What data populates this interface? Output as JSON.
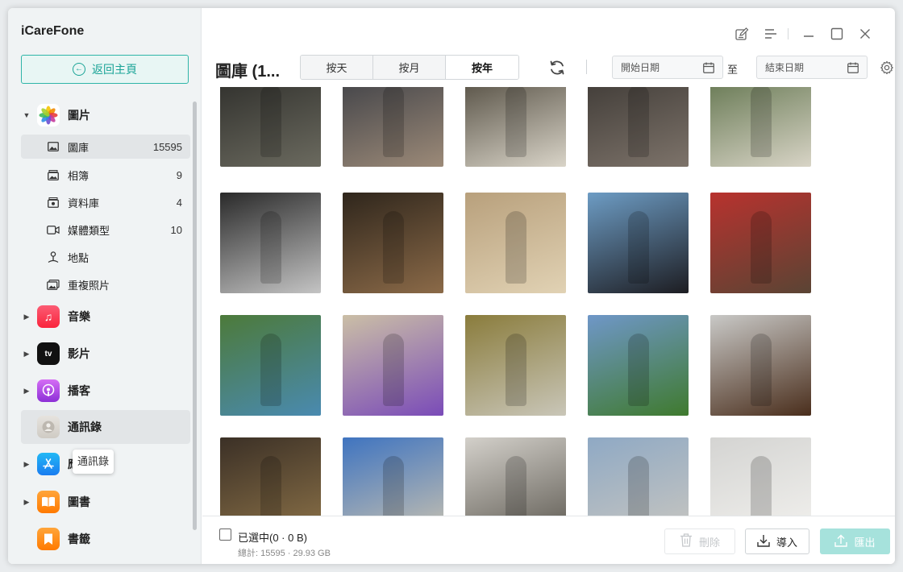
{
  "app": {
    "title": "iCareFone"
  },
  "sidebar": {
    "home_label": "返回主頁",
    "categories": [
      {
        "label": "圖片",
        "icon": "photos-app-icon",
        "expanded": true
      },
      {
        "label": "音樂",
        "icon": "music-app-icon"
      },
      {
        "label": "影片",
        "icon": "apple-tv-app-icon"
      },
      {
        "label": "播客",
        "icon": "podcasts-app-icon"
      },
      {
        "label": "通訊錄",
        "icon": "contacts-app-icon"
      },
      {
        "label": "應用",
        "icon": "app-store-icon"
      },
      {
        "label": "圖書",
        "icon": "books-app-icon"
      },
      {
        "label": "書籤",
        "icon": "bookmarks-app-icon"
      }
    ],
    "photo_items": [
      {
        "label": "圖庫",
        "count": "15595",
        "icon": "image-icon"
      },
      {
        "label": "相簿",
        "count": "9",
        "icon": "album-icon"
      },
      {
        "label": "資料庫",
        "count": "4",
        "icon": "library-icon"
      },
      {
        "label": "媒體類型",
        "count": "10",
        "icon": "video-camera-icon"
      },
      {
        "label": "地點",
        "count": "",
        "icon": "location-pin-icon"
      },
      {
        "label": "重複照片",
        "count": "",
        "icon": "duplicate-photos-icon"
      }
    ],
    "tooltip": "通訊錄"
  },
  "header": {
    "title": "圖庫 (1...",
    "tabs": [
      {
        "label": "按天"
      },
      {
        "label": "按月"
      },
      {
        "label": "按年",
        "active": true
      }
    ],
    "start_date_placeholder": "開始日期",
    "to_label": "至",
    "end_date_placeholder": "結束日期"
  },
  "grid": {
    "photos": [
      {
        "c1": "#2b2b28",
        "c2": "#6b6a5f"
      },
      {
        "c1": "#3a3d44",
        "c2": "#9c8a78"
      },
      {
        "c1": "#4a4438",
        "c2": "#d9d4c8"
      },
      {
        "c1": "#3b3733",
        "c2": "#7d736a"
      },
      {
        "c1": "#5c7048",
        "c2": "#d8d4c6"
      },
      {
        "c1": "#2a2a2a",
        "c2": "#c4c4c4"
      },
      {
        "c1": "#2f261c",
        "c2": "#8b6a48"
      },
      {
        "c1": "#b8a07c",
        "c2": "#e1d2b4"
      },
      {
        "c1": "#6d9cc4",
        "c2": "#1d1d22"
      },
      {
        "c1": "#b8322e",
        "c2": "#5a4434"
      },
      {
        "c1": "#4c7a3a",
        "c2": "#4a8ab0"
      },
      {
        "c1": "#cbbfa6",
        "c2": "#7a4bb8"
      },
      {
        "c1": "#8a7c3c",
        "c2": "#c9c6b8"
      },
      {
        "c1": "#6f97c8",
        "c2": "#3f7a2e"
      },
      {
        "c1": "#c9c9c7",
        "c2": "#4a2e1c"
      },
      {
        "c1": "#3b3026",
        "c2": "#8c7248"
      },
      {
        "c1": "#3f74c0",
        "c2": "#c9c2b0"
      },
      {
        "c1": "#d3d0ca",
        "c2": "#5e5a52"
      },
      {
        "c1": "#8fa9c4",
        "c2": "#c8c6c0"
      },
      {
        "c1": "#d4d4d2",
        "c2": "#f2f1ee"
      }
    ]
  },
  "footer": {
    "selected_text": "已選中(0 · 0 B)",
    "total_text": "總計: 15595 · 29.93 GB",
    "delete_label": "刪除",
    "import_label": "導入",
    "export_label": "匯出"
  }
}
